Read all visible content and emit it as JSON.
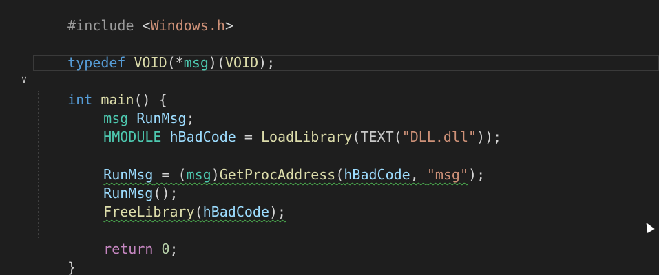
{
  "editor": {
    "fold_icon": "chevron-down-icon",
    "fold_glyph": "∨",
    "lines": {
      "l1": {
        "directive": "#include",
        "lt": " <",
        "header": "Windows.h",
        "gt": ">"
      },
      "l2": {
        "kw": "typedef",
        "sp": " ",
        "type": "VOID",
        "p1": "(*",
        "name": "msg",
        "p2": ")(",
        "arg": "VOID",
        "p3": ");"
      },
      "l3": {
        "kw": "int",
        "sp": " ",
        "fn": "main",
        "rest": "() {"
      },
      "l4": {
        "type": "msg",
        "sp": " ",
        "var": "RunMsg",
        "semi": ";"
      },
      "l5": {
        "type": "HMODULE",
        "sp": " ",
        "var": "hBadCode",
        "eq": " = ",
        "fn": "LoadLibrary",
        "p1": "(",
        "mac": "TEXT",
        "p2": "(",
        "str": "\"DLL.dll\"",
        "p3": "));"
      },
      "l6": {
        "var": "RunMsg",
        "eq": " = (",
        "type": "msg",
        "p1": ")",
        "fn": "GetProcAddress",
        "p2": "(",
        "arg": "hBadCode",
        "comma": ", ",
        "str": "\"msg\"",
        "p3": ");"
      },
      "l7": {
        "var": "RunMsg",
        "rest": "();"
      },
      "l8": {
        "fn": "FreeLibrary",
        "p1": "(",
        "arg": "hBadCode",
        "p2": ");"
      },
      "l9": {
        "kw": "return",
        "sp": " ",
        "num": "0",
        "semi": ";"
      },
      "l10": {
        "brace": "}"
      }
    }
  },
  "colors": {
    "background": "#1e1e1e",
    "keyword": "#569cd6",
    "control": "#c586c0",
    "type": "#4ec9b0",
    "function": "#dcdcaa",
    "variable": "#9cdcfe",
    "string": "#ce9178",
    "number": "#b5cea8",
    "squiggle": "#4caf50"
  }
}
